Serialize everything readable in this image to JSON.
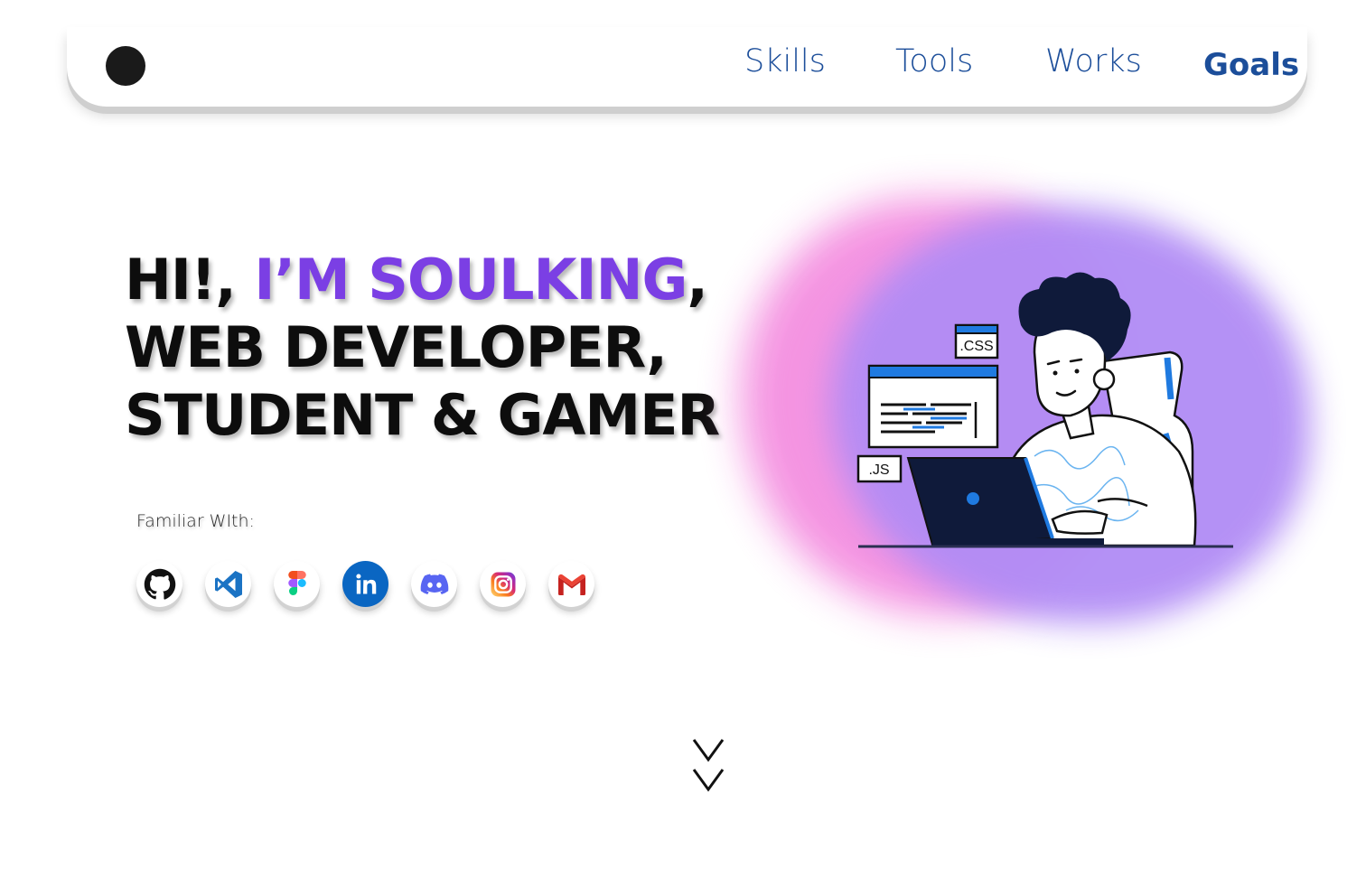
{
  "nav": {
    "items": [
      {
        "label": "Skills",
        "active": false
      },
      {
        "label": "Tools",
        "active": false
      },
      {
        "label": "Works",
        "active": false
      },
      {
        "label": "Goals",
        "active": true
      }
    ],
    "link_color": "#1c4e9a"
  },
  "hero": {
    "line1_prefix": "HI!, ",
    "line1_name": "I’M SOULKING",
    "line1_suffix": ",",
    "line2": "WEB DEVELOPER,",
    "line3": "STUDENT & GAMER",
    "accent_color": "#7b3fe4",
    "familiar_label": "Familiar WIth:",
    "socials": [
      {
        "icon": "github-icon"
      },
      {
        "icon": "vscode-icon"
      },
      {
        "icon": "figma-icon"
      },
      {
        "icon": "linkedin-icon"
      },
      {
        "icon": "discord-icon"
      },
      {
        "icon": "instagram-icon"
      },
      {
        "icon": "gmail-icon"
      }
    ]
  },
  "illustration": {
    "css_tag": ".CSS",
    "js_tag": ".JS"
  },
  "scroll": {
    "icon": "double-chevron-down-icon"
  }
}
